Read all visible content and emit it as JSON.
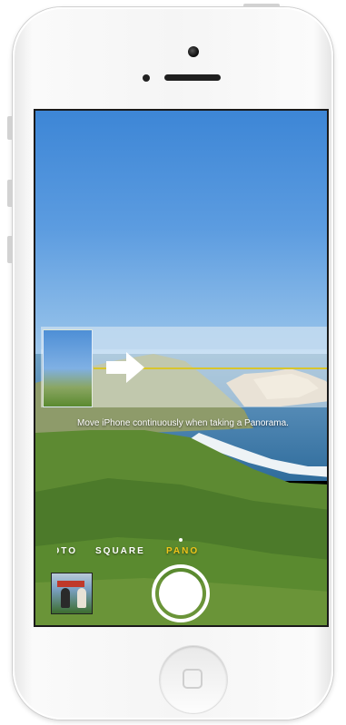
{
  "camera": {
    "hint_text": "Move iPhone continuously when taking a Panorama.",
    "modes": [
      {
        "label": "PHOTO"
      },
      {
        "label": "SQUARE"
      },
      {
        "label": "PANO"
      }
    ],
    "active_mode": "PANO",
    "active_color": "#f0c419",
    "guide_line_color": "#d8c52c",
    "icons": {
      "direction_arrow": "right-arrow-icon",
      "shutter": "shutter-button",
      "last_photo": "photo-thumbnail"
    }
  }
}
